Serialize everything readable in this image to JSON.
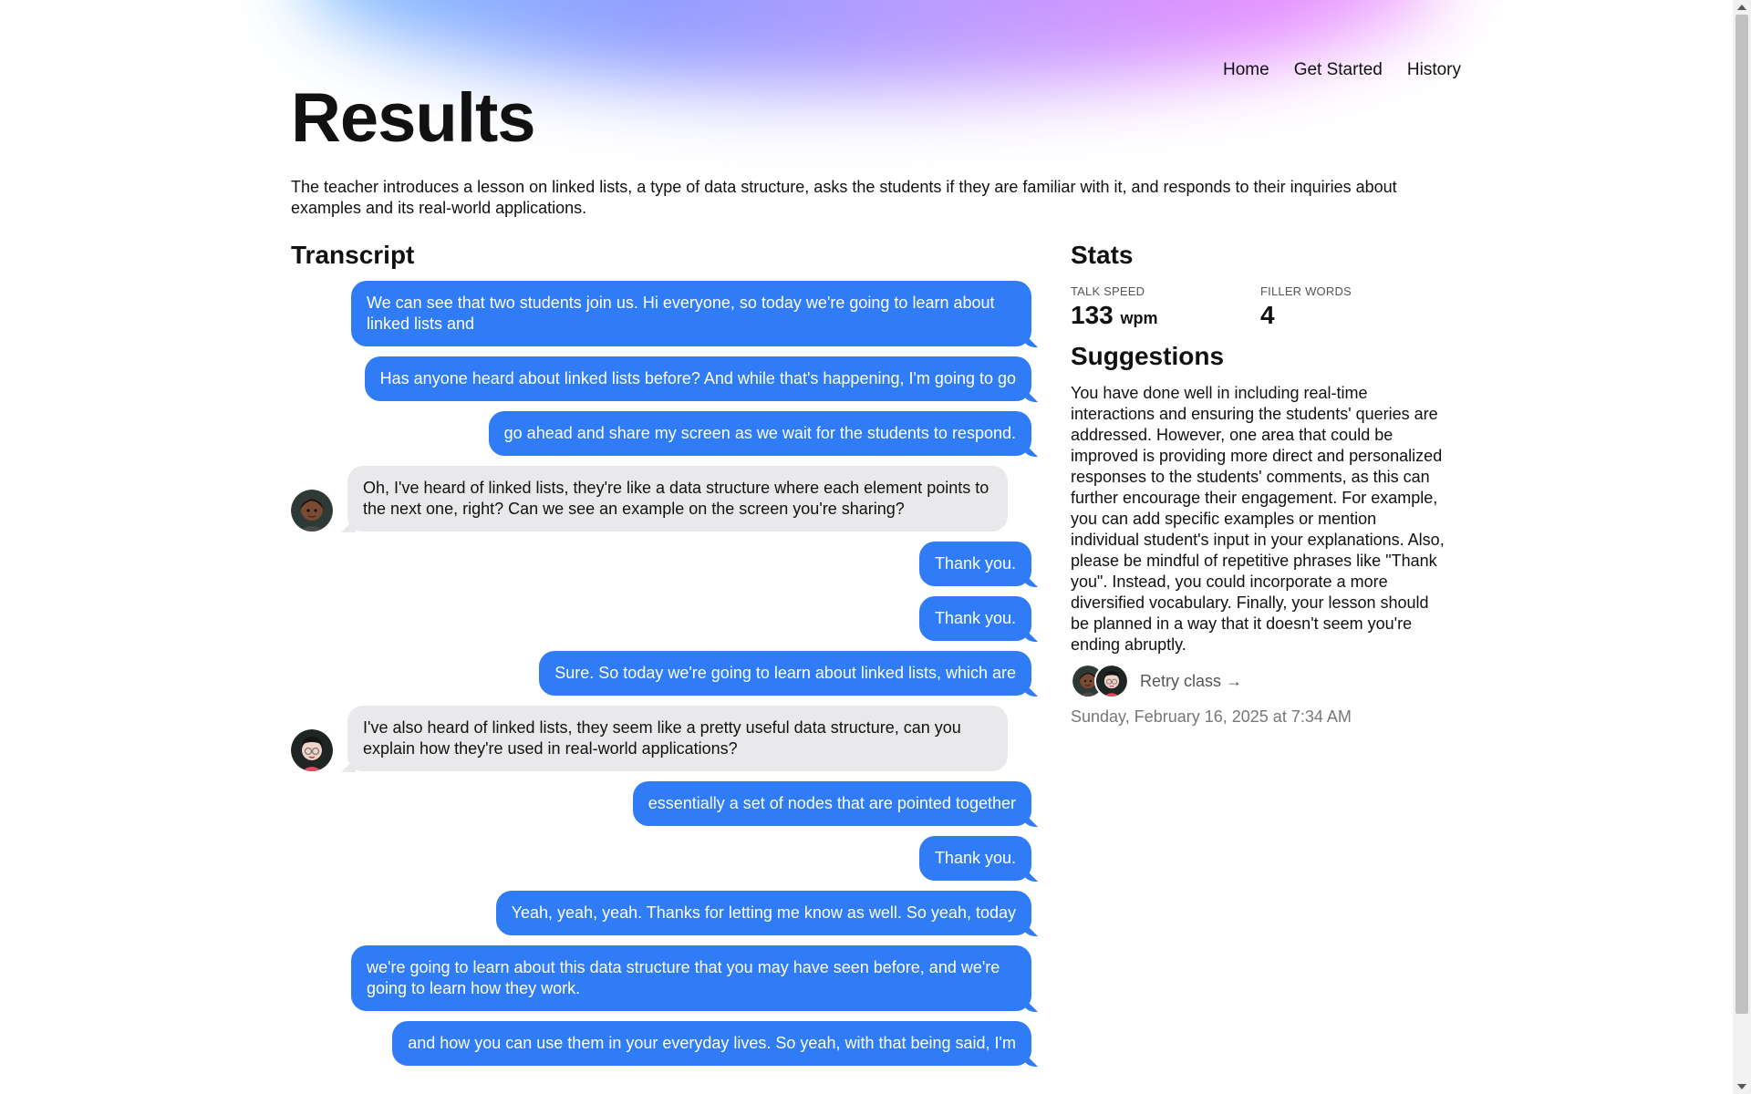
{
  "nav": {
    "items": [
      "Home",
      "Get Started",
      "History"
    ]
  },
  "page": {
    "title": "Results",
    "summary": "The teacher introduces a lesson on linked lists, a type of data structure, asks the students if they are familiar with it, and responds to their inquiries about examples and its real-world applications."
  },
  "transcript": {
    "heading": "Transcript",
    "messages": [
      {
        "speaker": "teacher",
        "text": "We can see that two students join us. Hi everyone, so today we're going to learn about linked lists and"
      },
      {
        "speaker": "teacher",
        "text": "Has anyone heard about linked lists before? And while that's happening, I'm going to go"
      },
      {
        "speaker": "teacher",
        "text": "go ahead and share my screen as we wait for the students to respond."
      },
      {
        "speaker": "student",
        "avatar": "student-1",
        "text": "Oh, I've heard of linked lists, they're like a data structure where each element points to the next one, right? Can we see an example on the screen you're sharing?"
      },
      {
        "speaker": "teacher",
        "text": "Thank you."
      },
      {
        "speaker": "teacher",
        "text": "Thank you."
      },
      {
        "speaker": "teacher",
        "text": "Sure. So today we're going to learn about linked lists, which are"
      },
      {
        "speaker": "student",
        "avatar": "student-2",
        "text": "I've also heard of linked lists, they seem like a pretty useful data structure, can you explain how they're used in real-world applications?"
      },
      {
        "speaker": "teacher",
        "text": "essentially a set of nodes that are pointed together"
      },
      {
        "speaker": "teacher",
        "text": "Thank you."
      },
      {
        "speaker": "teacher",
        "text": "Yeah, yeah, yeah. Thanks for letting me know as well. So yeah, today"
      },
      {
        "speaker": "teacher",
        "text": "we're going to learn about this data structure that you may have seen before, and we're going to learn how they work."
      },
      {
        "speaker": "teacher",
        "text": "and how you can use them in your everyday lives. So yeah, with that being said, I'm"
      }
    ]
  },
  "stats": {
    "heading": "Stats",
    "talk_speed_label": "TALK SPEED",
    "talk_speed_value": "133",
    "talk_speed_unit": "wpm",
    "filler_words_label": "FILLER WORDS",
    "filler_words_value": "4"
  },
  "suggestions": {
    "heading": "Suggestions",
    "text": "You have done well in including real-time interactions and ensuring the students' queries are addressed. However, one area that could be improved is providing more direct and personalized responses to the students' comments, as this can further encourage their engagement. For example, you can add specific examples or mention individual student's input in your explanations. Also, please be mindful of repetitive phrases like \"Thank you\". Instead, you could incorporate a more diversified vocabulary. Finally, your lesson should be planned in a way that it doesn't seem you're ending abruptly."
  },
  "retry": {
    "label": "Retry class →"
  },
  "timestamp": "Sunday, February 16, 2025 at 7:34 AM",
  "colors": {
    "teacher_bubble": "#2f7cf6",
    "student_bubble": "#e9e9eb"
  }
}
